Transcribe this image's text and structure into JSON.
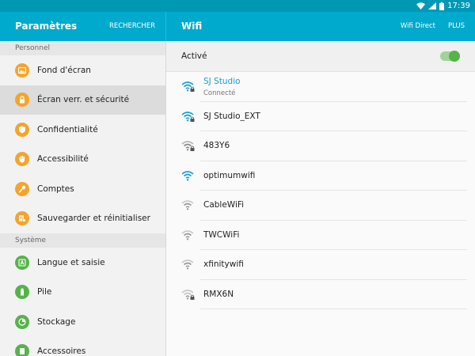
{
  "statusbar": {
    "time": "17:39"
  },
  "appbar": {
    "title": "Paramètres",
    "search_label": "RECHERCHER",
    "right_title": "Wifi",
    "wifi_direct_label": "Wifi Direct",
    "more_label": "PLUS"
  },
  "sidebar": {
    "sections": [
      {
        "title": "Personnel",
        "items": [
          {
            "label": "Fond d'écran",
            "icon": "wallpaper-icon",
            "color": "#f4a42b"
          },
          {
            "label": "Écran verr. et sécurité",
            "icon": "lock-icon",
            "color": "#f4a42b",
            "selected": true
          },
          {
            "label": "Confidentialité",
            "icon": "shield-icon",
            "color": "#f4a42b"
          },
          {
            "label": "Accessibilité",
            "icon": "hand-icon",
            "color": "#f4a42b"
          },
          {
            "label": "Comptes",
            "icon": "key-icon",
            "color": "#f4a42b"
          },
          {
            "label": "Sauvegarder et réinitialiser",
            "icon": "backup-icon",
            "color": "#f4a42b"
          }
        ]
      },
      {
        "title": "Système",
        "items": [
          {
            "label": "Langue et saisie",
            "icon": "language-icon",
            "color": "#56b34a"
          },
          {
            "label": "Pile",
            "icon": "battery-icon",
            "color": "#56b34a"
          },
          {
            "label": "Stockage",
            "icon": "storage-icon",
            "color": "#56b34a"
          },
          {
            "label": "Accessoires",
            "icon": "accessory-icon",
            "color": "#56b34a"
          }
        ]
      }
    ]
  },
  "wifi": {
    "active_label": "Activé",
    "toggle_on": true,
    "networks": [
      {
        "name": "SJ Studio",
        "status": "Connecté",
        "locked": true,
        "strength": 3,
        "connected": true
      },
      {
        "name": "SJ Studio_EXT",
        "locked": true,
        "strength": 3
      },
      {
        "name": "483Y6",
        "locked": true,
        "strength": 2
      },
      {
        "name": "optimumwifi",
        "locked": false,
        "strength": 3
      },
      {
        "name": "CableWiFi",
        "locked": false,
        "strength": 2
      },
      {
        "name": "TWCWiFi",
        "locked": false,
        "strength": 2
      },
      {
        "name": "xfinitywifi",
        "locked": false,
        "strength": 2
      },
      {
        "name": "RMX6N",
        "locked": true,
        "strength": 1
      }
    ],
    "colors": {
      "signal": "#1a9fcf",
      "signal_dim": "#b5b5b5",
      "accent": "#00aacc"
    }
  }
}
